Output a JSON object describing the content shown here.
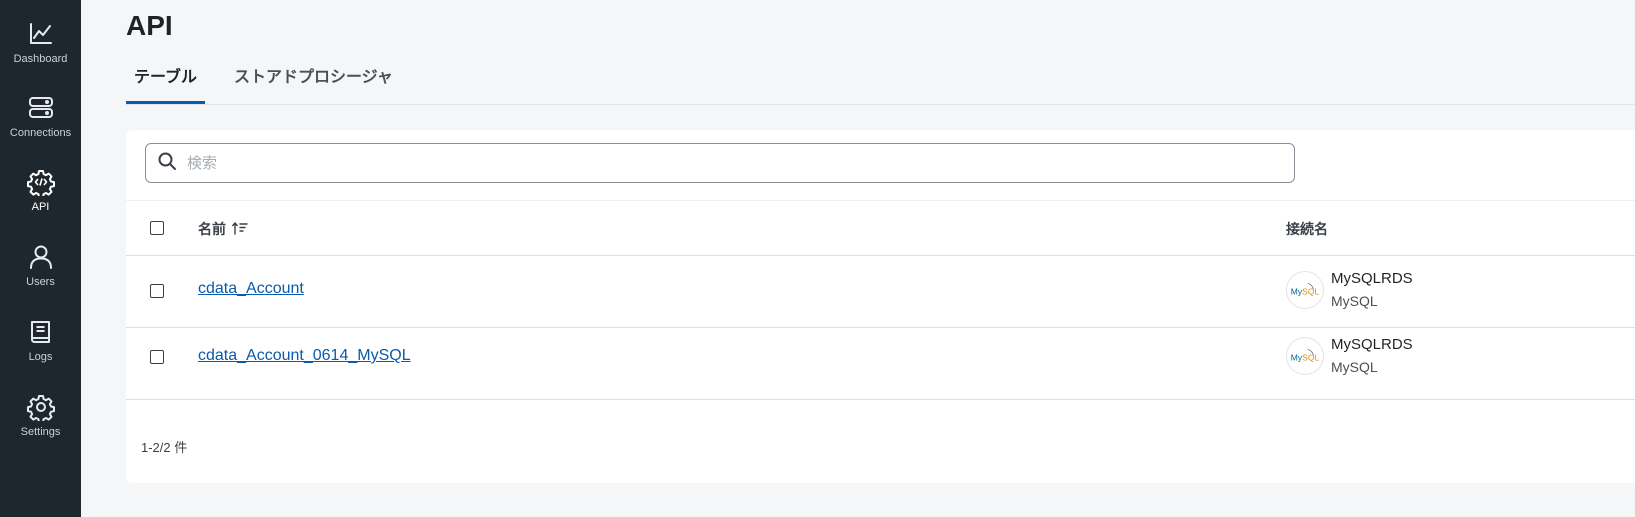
{
  "sidebar": {
    "items": [
      {
        "label": "Dashboard",
        "icon": "chart-line-icon"
      },
      {
        "label": "Connections",
        "icon": "server-icon"
      },
      {
        "label": "API",
        "icon": "api-gear-icon",
        "active": true
      },
      {
        "label": "Users",
        "icon": "user-icon"
      },
      {
        "label": "Logs",
        "icon": "book-icon"
      },
      {
        "label": "Settings",
        "icon": "gear-icon"
      }
    ]
  },
  "header": {
    "title": "API"
  },
  "tabs": [
    {
      "label": "テーブル",
      "active": true
    },
    {
      "label": "ストアドプロシージャ",
      "active": false
    }
  ],
  "search": {
    "placeholder": "検索",
    "value": ""
  },
  "table": {
    "columns": {
      "name": "名前",
      "connection": "接続名"
    },
    "rows": [
      {
        "name": "cdata_Account",
        "connection_name": "MySQLRDS",
        "connection_type": "MySQL",
        "logo_text": "MySQL"
      },
      {
        "name": "cdata_Account_0614_MySQL",
        "connection_name": "MySQLRDS",
        "connection_type": "MySQL",
        "logo_text": "MySQL"
      }
    ]
  },
  "pagination": {
    "summary": "1-2/2 件"
  },
  "colors": {
    "sidebar_bg": "#1e272d",
    "accent": "#0a5bab",
    "page_bg": "#f5f6f8"
  }
}
